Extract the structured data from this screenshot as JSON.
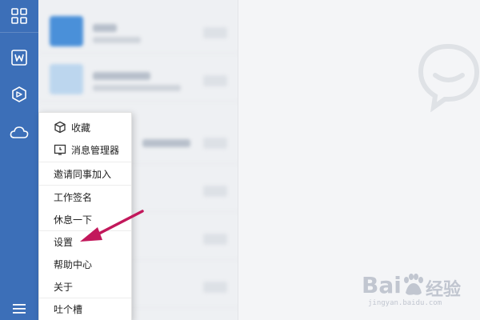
{
  "menu": {
    "items": [
      {
        "label": "收藏",
        "icon": "cube-icon"
      },
      {
        "label": "消息管理器",
        "icon": "message-manager-icon"
      },
      {
        "label": "邀请同事加入"
      },
      {
        "label": "工作签名"
      },
      {
        "label": "休息一下"
      },
      {
        "label": "设置"
      },
      {
        "label": "帮助中心"
      },
      {
        "label": "关于"
      },
      {
        "label": "吐个槽"
      }
    ]
  },
  "sidebar": {
    "icons": [
      "grid-icon",
      "docs-w-icon",
      "workbench-icon",
      "cloud-icon",
      "hamburger-menu-icon"
    ]
  },
  "watermark": {
    "brand_word": "Bai",
    "brand_cn": "经验",
    "url": "jingyan.baidu.com"
  },
  "colors": {
    "sidebar": "#3c6fb8",
    "arrow": "#c2185b",
    "menu_bg": "#ffffff"
  }
}
